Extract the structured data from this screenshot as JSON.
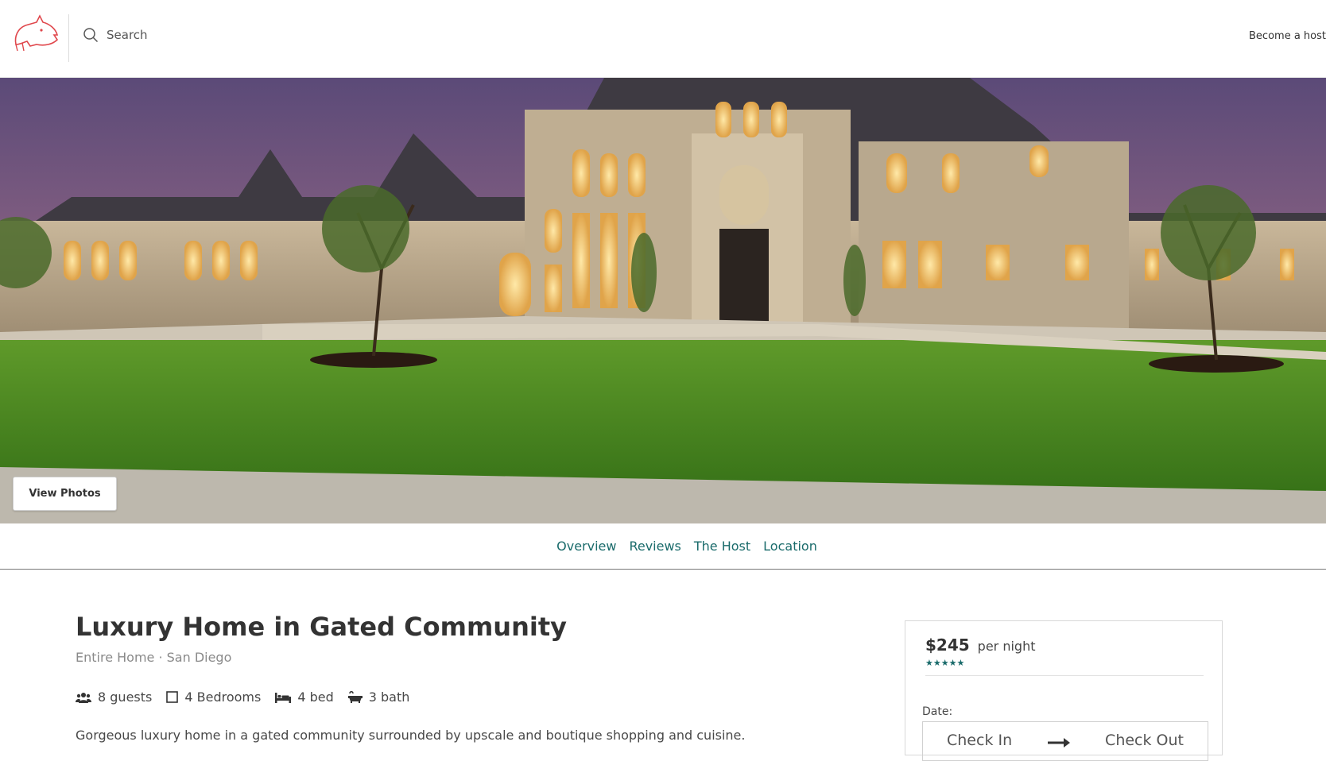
{
  "header": {
    "search_placeholder": "Search",
    "become_host": "Become a host"
  },
  "hero": {
    "view_photos_label": "View Photos"
  },
  "tabs": [
    {
      "label": "Overview"
    },
    {
      "label": "Reviews"
    },
    {
      "label": "The Host"
    },
    {
      "label": "Location"
    }
  ],
  "listing": {
    "title": "Luxury Home in Gated Community",
    "subtitle": "Entire Home · San Diego",
    "amenities": {
      "guests": "8 guests",
      "bedrooms": "4 Bedrooms",
      "beds": "4 bed",
      "baths": "3 bath"
    },
    "description": "Gorgeous luxury home in a gated community surrounded by upscale and boutique shopping and cuisine."
  },
  "booking": {
    "price": "$245",
    "per_night": "per night",
    "rating_stars": "★★★★★",
    "date_label": "Date:",
    "check_in": "Check In",
    "check_out": "Check Out"
  },
  "colors": {
    "accent": "#1a6b6b",
    "logo": "#e0474c"
  },
  "icons": {
    "logo": "pig-logo",
    "search": "search-icon",
    "guests": "users-icon",
    "bedrooms": "square-icon",
    "beds": "bed-icon",
    "baths": "bath-icon",
    "arrow": "arrow-right-icon"
  }
}
